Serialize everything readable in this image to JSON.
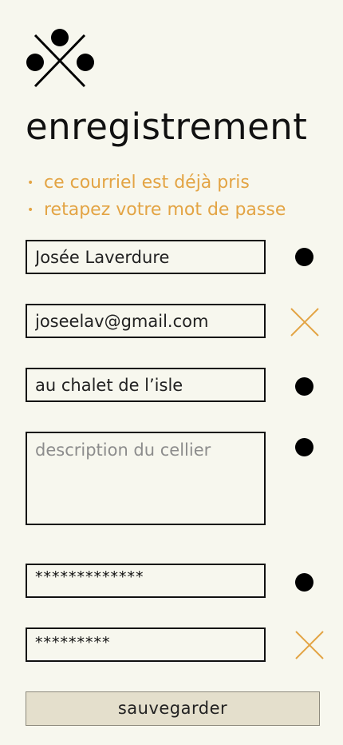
{
  "page": {
    "title": "enregistrement"
  },
  "errors": [
    "ce courriel est déjà pris",
    "retapez votre mot de passe"
  ],
  "form": {
    "name_value": "Josée Laverdure",
    "email_value": "joseelav@gmail.com",
    "cellar_name_value": "au chalet de l’isle",
    "description_placeholder": "description du cellier",
    "password_value": "*************",
    "password_confirm_value": "*********"
  },
  "status": {
    "name": "ok",
    "email": "error",
    "cellar_name": "ok",
    "description": "ok",
    "password": "ok",
    "password_confirm": "error"
  },
  "actions": {
    "save_label": "sauvegarder"
  },
  "colors": {
    "background": "#f7f7ee",
    "error": "#e3a444",
    "button_bg": "#e4dfcc",
    "ink": "#111111"
  },
  "icons": {
    "logo": "cork-x-logo-icon",
    "valid": "dot-icon",
    "invalid": "x-icon"
  }
}
